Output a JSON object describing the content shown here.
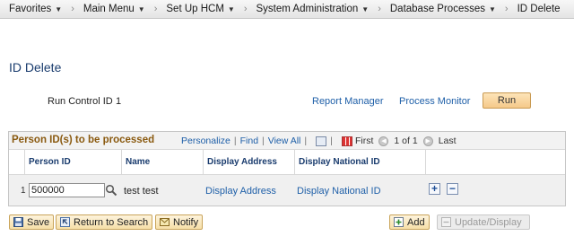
{
  "nav": {
    "items": [
      {
        "label": "Favorites",
        "caret": "▼"
      },
      {
        "label": "Main Menu",
        "caret": "▼"
      },
      {
        "label": "Set Up HCM",
        "caret": "▼"
      },
      {
        "label": "System Administration",
        "caret": "▼"
      },
      {
        "label": "Database Processes",
        "caret": "▼"
      },
      {
        "label": "ID Delete",
        "caret": ""
      }
    ],
    "separator": "›"
  },
  "page": {
    "title": "ID Delete"
  },
  "run_control": {
    "label": "Run Control ID",
    "value": "1",
    "report_manager": "Report Manager",
    "process_monitor": "Process Monitor",
    "run_button": "Run"
  },
  "grid": {
    "title": "Person ID(s) to be processed",
    "personalize": "Personalize",
    "find": "Find",
    "view_all": "View All",
    "tool_sep": "|",
    "first": "First",
    "range": "1 of 1",
    "last": "Last",
    "columns": [
      "Person ID",
      "Name",
      "Display Address",
      "Display National ID"
    ],
    "rows": [
      {
        "num": "1",
        "person_id": "500000",
        "name": "test test",
        "address": "Display Address",
        "national_id": "Display National ID"
      }
    ],
    "add_row": "+",
    "delete_row": "−"
  },
  "toolbar": {
    "save": "Save",
    "return_to_search": "Return to Search",
    "notify": "Notify",
    "add": "Add",
    "update_display": "Update/Display"
  },
  "icons": {
    "save": "save-icon",
    "return": "return-icon",
    "notify": "notify-icon",
    "add": "add-icon",
    "update": "update-icon",
    "lookup": "magnifier-icon"
  },
  "colors": {
    "link": "#1e5fa8",
    "grid_title": "#8a5a10",
    "heading": "#1a3c6e",
    "button_bg": "#f6dfa8"
  }
}
